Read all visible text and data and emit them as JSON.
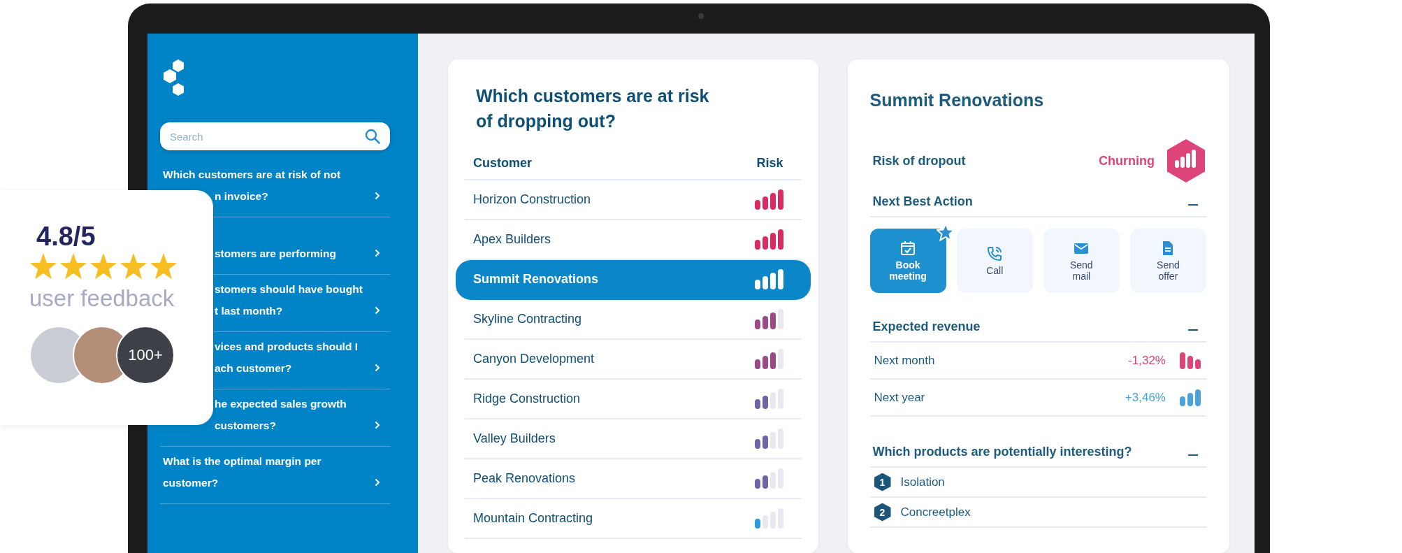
{
  "sidebar": {
    "search": {
      "placeholder": "Search"
    },
    "items": [
      {
        "lines": [
          "Which customers are at risk of not",
          "n invoice?"
        ]
      },
      {
        "lines": [
          "stomers are performing"
        ]
      },
      {
        "lines": [
          "stomers should have bought",
          "t last month?"
        ]
      },
      {
        "lines": [
          "vices and products should I",
          "ach customer?"
        ]
      },
      {
        "lines": [
          "he expected sales growth",
          "customers?"
        ]
      },
      {
        "lines": [
          "What is the optimal margin per",
          "customer?"
        ]
      }
    ]
  },
  "feedback": {
    "score": "4.8/5",
    "stars": 5,
    "label": "user feedback",
    "avatar_count": "100+"
  },
  "risk_table": {
    "title": "Which customers are at risk of dropping out?",
    "columns": [
      "Customer",
      "Risk"
    ],
    "rows": [
      {
        "customer": "Horizon Construction",
        "level": 1,
        "color": "#d92c63",
        "selected": false
      },
      {
        "customer": "Apex Builders",
        "level": 1,
        "color": "#d92c63",
        "selected": false
      },
      {
        "customer": "Summit Renovations",
        "level": 1,
        "color": "#ffffff",
        "selected": true
      },
      {
        "customer": "Skyline Contracting",
        "level": 0.75,
        "color": "#9a4a86",
        "selected": false
      },
      {
        "customer": "Canyon Development",
        "level": 0.75,
        "color": "#9a4a86",
        "selected": false
      },
      {
        "customer": "Ridge Construction",
        "level": 0.5,
        "color": "#6e65a6",
        "selected": false
      },
      {
        "customer": "Valley Builders",
        "level": 0.5,
        "color": "#6e65a6",
        "selected": false
      },
      {
        "customer": "Peak Renovations",
        "level": 0.5,
        "color": "#6e65a6",
        "selected": false
      },
      {
        "customer": "Mountain Contracting",
        "level": 0.25,
        "color": "#2f9ad8",
        "selected": false
      }
    ]
  },
  "detail": {
    "title": "Summit Renovations",
    "risk_label": "Risk of dropout",
    "risk_status": "Churning",
    "next_best_action": {
      "title": "Next Best Action",
      "actions": [
        {
          "label": "Book meeting",
          "kind": "calendar",
          "selected": true,
          "recommended": true
        },
        {
          "label": "Call",
          "kind": "phone",
          "selected": false,
          "recommended": false
        },
        {
          "label": "Send mail",
          "kind": "mail",
          "selected": false,
          "recommended": false
        },
        {
          "label": "Send offer",
          "kind": "document",
          "selected": false,
          "recommended": false
        }
      ]
    },
    "expected_revenue": {
      "title": "Expected revenue",
      "rows": [
        {
          "label": "Next month",
          "value": "-1,32%",
          "color": "#dd4479",
          "kind": "down"
        },
        {
          "label": "Next year",
          "value": "+3,46%",
          "color": "#4aa3dc",
          "kind": "up"
        }
      ]
    },
    "products": {
      "title": "Which products are potentially interesting?",
      "items": [
        {
          "number": "1",
          "name": "Isolation"
        },
        {
          "number": "2",
          "name": "Concreetplex"
        }
      ]
    }
  }
}
